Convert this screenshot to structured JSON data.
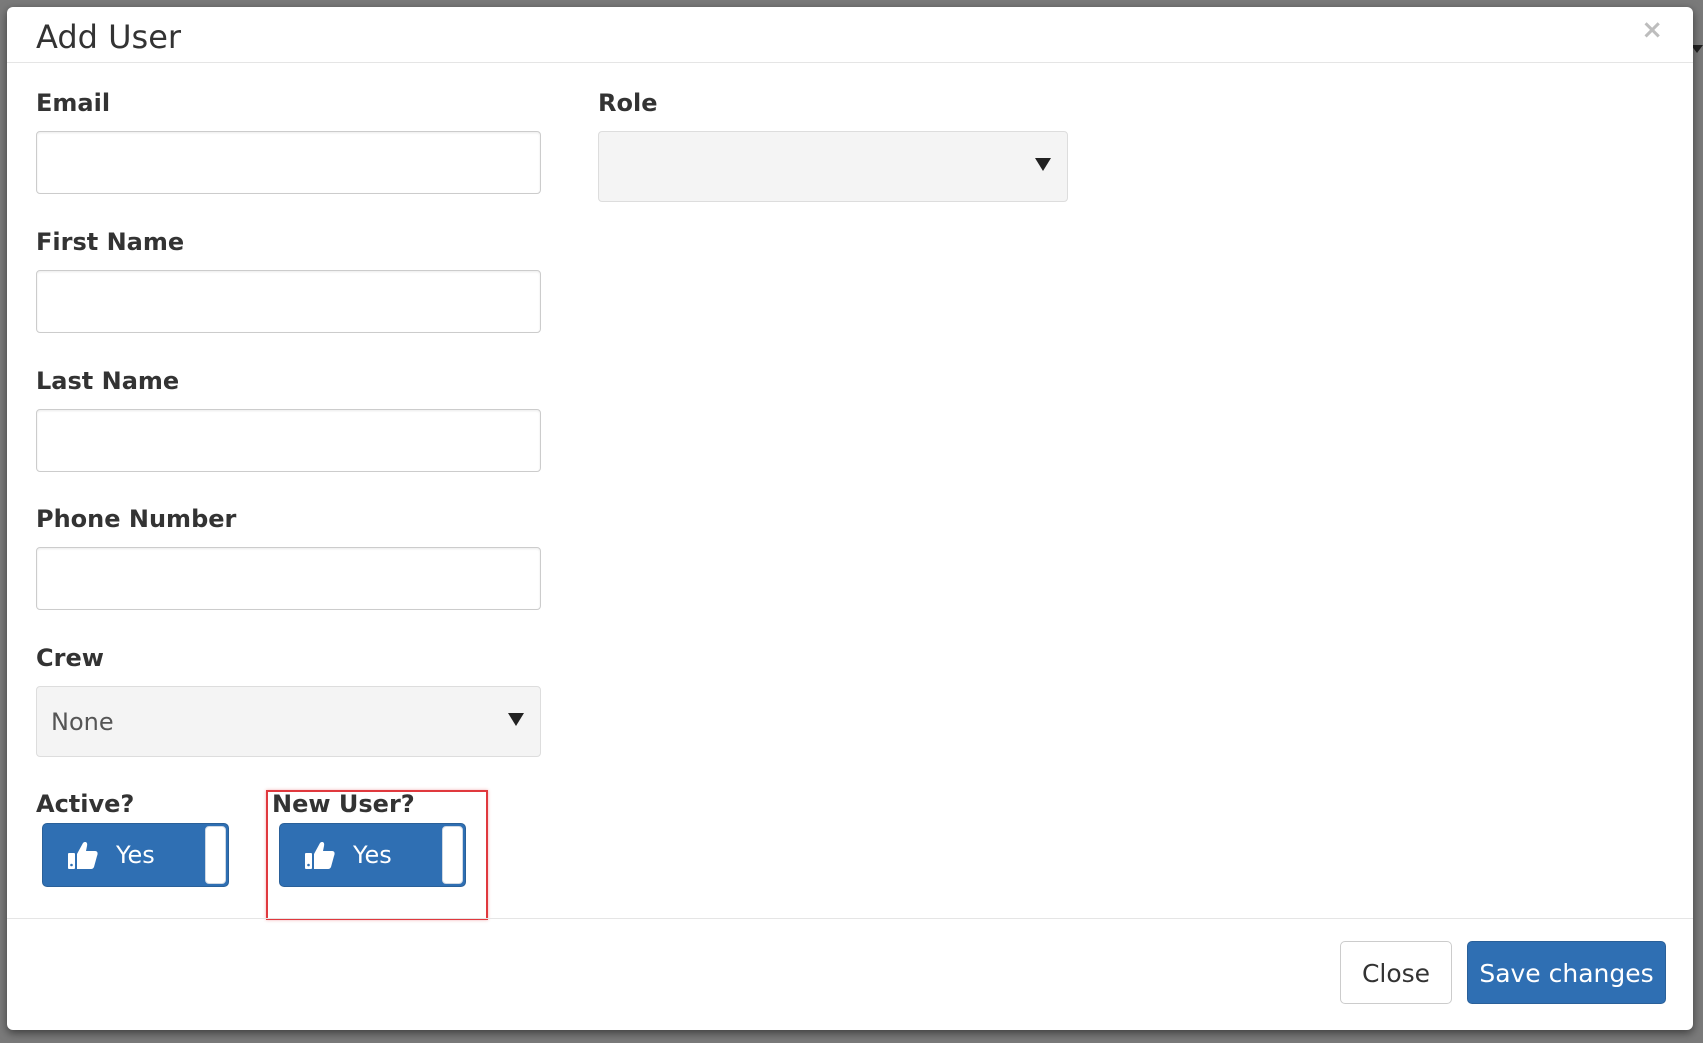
{
  "modal": {
    "title": "Add User",
    "close_glyph": "×"
  },
  "form": {
    "email": {
      "label": "Email",
      "value": "",
      "placeholder": ""
    },
    "first_name": {
      "label": "First Name",
      "value": "",
      "placeholder": ""
    },
    "last_name": {
      "label": "Last Name",
      "value": "",
      "placeholder": ""
    },
    "phone": {
      "label": "Phone Number",
      "value": "",
      "placeholder": ""
    },
    "crew": {
      "label": "Crew",
      "selected": "None"
    },
    "role": {
      "label": "Role",
      "selected": ""
    },
    "active": {
      "label": "Active?",
      "state_label": "Yes",
      "on": true,
      "icon": "thumbs-up-icon"
    },
    "new_user": {
      "label": "New User?",
      "state_label": "Yes",
      "on": true,
      "icon": "thumbs-up-icon"
    }
  },
  "footer": {
    "close_label": "Close",
    "save_label": "Save changes"
  },
  "colors": {
    "primary": "#2f6fb3",
    "highlight": "#e0393e"
  }
}
